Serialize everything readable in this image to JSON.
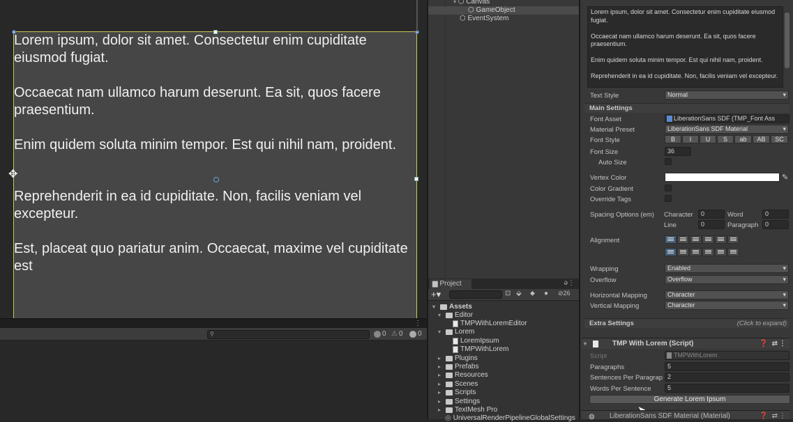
{
  "scene": {
    "paragraphs": [
      "Lorem ipsum, dolor sit amet. Consectetur enim cupiditate eiusmod fugiat.",
      "Occaecat nam ullamco harum deserunt. Ea sit, quos facere praesentium.",
      "Enim quidem soluta minim tempor. Est qui nihil nam, proident.",
      "Reprehenderit in ea id cupiditate. Non, facilis veniam vel excepteur.",
      "Est, placeat quo pariatur anim. Occaecat, maxime vel cupiditate est"
    ]
  },
  "console": {
    "error_count": "0",
    "warning_count": "0",
    "info_count": "0"
  },
  "hierarchy": {
    "items": [
      "Canvas",
      "GameObject",
      "EventSystem"
    ],
    "selected": "GameObject"
  },
  "project": {
    "tab_label": "Project",
    "hidden_count": "26",
    "tree": [
      {
        "label": "Assets",
        "type": "folder",
        "expanded": true
      },
      {
        "label": "Editor",
        "type": "folder",
        "expanded": true
      },
      {
        "label": "TMPWithLoremEditor",
        "type": "script"
      },
      {
        "label": "Lorem",
        "type": "folder",
        "expanded": true
      },
      {
        "label": "LoremIpsum",
        "type": "script"
      },
      {
        "label": "TMPWithLorem",
        "type": "script"
      },
      {
        "label": "Plugins",
        "type": "folder"
      },
      {
        "label": "Prefabs",
        "type": "folder"
      },
      {
        "label": "Resources",
        "type": "folder"
      },
      {
        "label": "Scenes",
        "type": "folder"
      },
      {
        "label": "Scripts",
        "type": "folder"
      },
      {
        "label": "Settings",
        "type": "folder"
      },
      {
        "label": "TextMesh Pro",
        "type": "folder"
      },
      {
        "label": "UniversalRenderPipelineGlobalSettings",
        "type": "asset"
      }
    ]
  },
  "inspector": {
    "text_input": [
      "Lorem ipsum, dolor sit amet. Consectetur enim cupiditate eiusmod fugiat.",
      "Occaecat nam ullamco harum deserunt. Ea sit, quos facere praesentium.",
      "Enim quidem soluta minim tempor. Est qui nihil nam, proident.",
      "Reprehenderit in ea id cupiditate. Non, facilis veniam vel excepteur."
    ],
    "text_style_label": "Text Style",
    "text_style_value": "Normal",
    "main_settings": "Main Settings",
    "font_asset_label": "Font Asset",
    "font_asset_value": "LiberationSans SDF (TMP_Font Ass",
    "material_preset_label": "Material Preset",
    "material_preset_value": "LiberationSans SDF Material",
    "font_style_label": "Font Style",
    "font_style_buttons": [
      "B",
      "I",
      "U",
      "S",
      "ab",
      "AB",
      "SC"
    ],
    "font_size_label": "Font Size",
    "font_size_value": "36",
    "auto_size_label": "Auto Size",
    "vertex_color_label": "Vertex Color",
    "color_gradient_label": "Color Gradient",
    "override_tags_label": "Override Tags",
    "spacing_label": "Spacing Options (em)",
    "character_label": "Character",
    "character_value": "0",
    "word_label": "Word",
    "word_value": "0",
    "line_label": "Line",
    "line_value": "0",
    "paragraph_label": "Paragraph",
    "paragraph_value": "0",
    "alignment_label": "Alignment",
    "wrapping_label": "Wrapping",
    "wrapping_value": "Enabled",
    "overflow_label": "Overflow",
    "overflow_value": "Overflow",
    "h_mapping_label": "Horizontal Mapping",
    "h_mapping_value": "Character",
    "v_mapping_label": "Vertical Mapping",
    "v_mapping_value": "Character",
    "extra_settings": "Extra Settings",
    "extra_hint": "(Click to expand)",
    "component_title": "TMP With Lorem (Script)",
    "script_label": "Script",
    "script_value": "TMPWithLorem",
    "paragraphs_label": "Paragraphs",
    "paragraphs_value": "5",
    "sentences_label": "Sentences Per Paragrap",
    "sentences_value": "2",
    "words_label": "Words Per Sentence",
    "words_value": "5",
    "generate_button": "Generate Lorem Ipsum",
    "material_header": "LiberationSans SDF Material (Material)"
  },
  "colors": {
    "selection_outline": "#c8c85a",
    "vertex_color": "#ffffff",
    "active_toggle": "#46607c"
  }
}
